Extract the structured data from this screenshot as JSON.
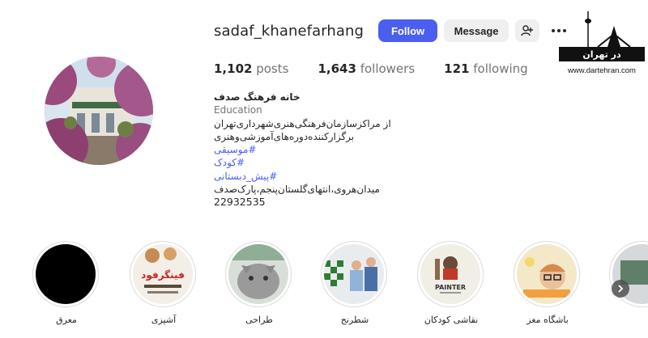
{
  "profile": {
    "username": "sadaf_khanefarhang",
    "follow_label": "Follow",
    "message_label": "Message",
    "more_glyph": "•••"
  },
  "stats": {
    "posts_count": "1,102",
    "posts_label": "posts",
    "followers_count": "1,643",
    "followers_label": "followers",
    "following_count": "121",
    "following_label": "following"
  },
  "bio": {
    "name": "خانه فرهنگ صدف",
    "category": "Education",
    "line1": "از مراکزسازمان‌فرهنگی‌هنری‌شهرداری‌تهران",
    "line2": "برگزارکننده‌دوره‌های‌آموزشی‌وهنری",
    "tag1": "#موسیقی",
    "tag2": "#کودک",
    "tag3": "#پیش_دبستانی",
    "address": "میدان‌هروی،انتهای‌گلستان‌پنجم،پارک‌صدف",
    "phone": "22932535"
  },
  "watermark": {
    "brand": "در تهران",
    "site": "www.dartehran.com"
  },
  "highlights": [
    {
      "caption": "معرق",
      "thumb_text": ""
    },
    {
      "caption": "آشپزی",
      "thumb_text": "فینگرفود"
    },
    {
      "caption": "طراحی",
      "thumb_text": ""
    },
    {
      "caption": "شطرنج",
      "thumb_text": ""
    },
    {
      "caption": "نقاشی کودکان",
      "thumb_text": "PAINTER"
    },
    {
      "caption": "باشگاه مغز",
      "thumb_text": ""
    },
    {
      "caption": "",
      "thumb_text": ""
    }
  ],
  "colors": {
    "follow_bg": "#4a5ef0",
    "hashtag": "#4a5ef0",
    "secondary_text": "#737373"
  }
}
